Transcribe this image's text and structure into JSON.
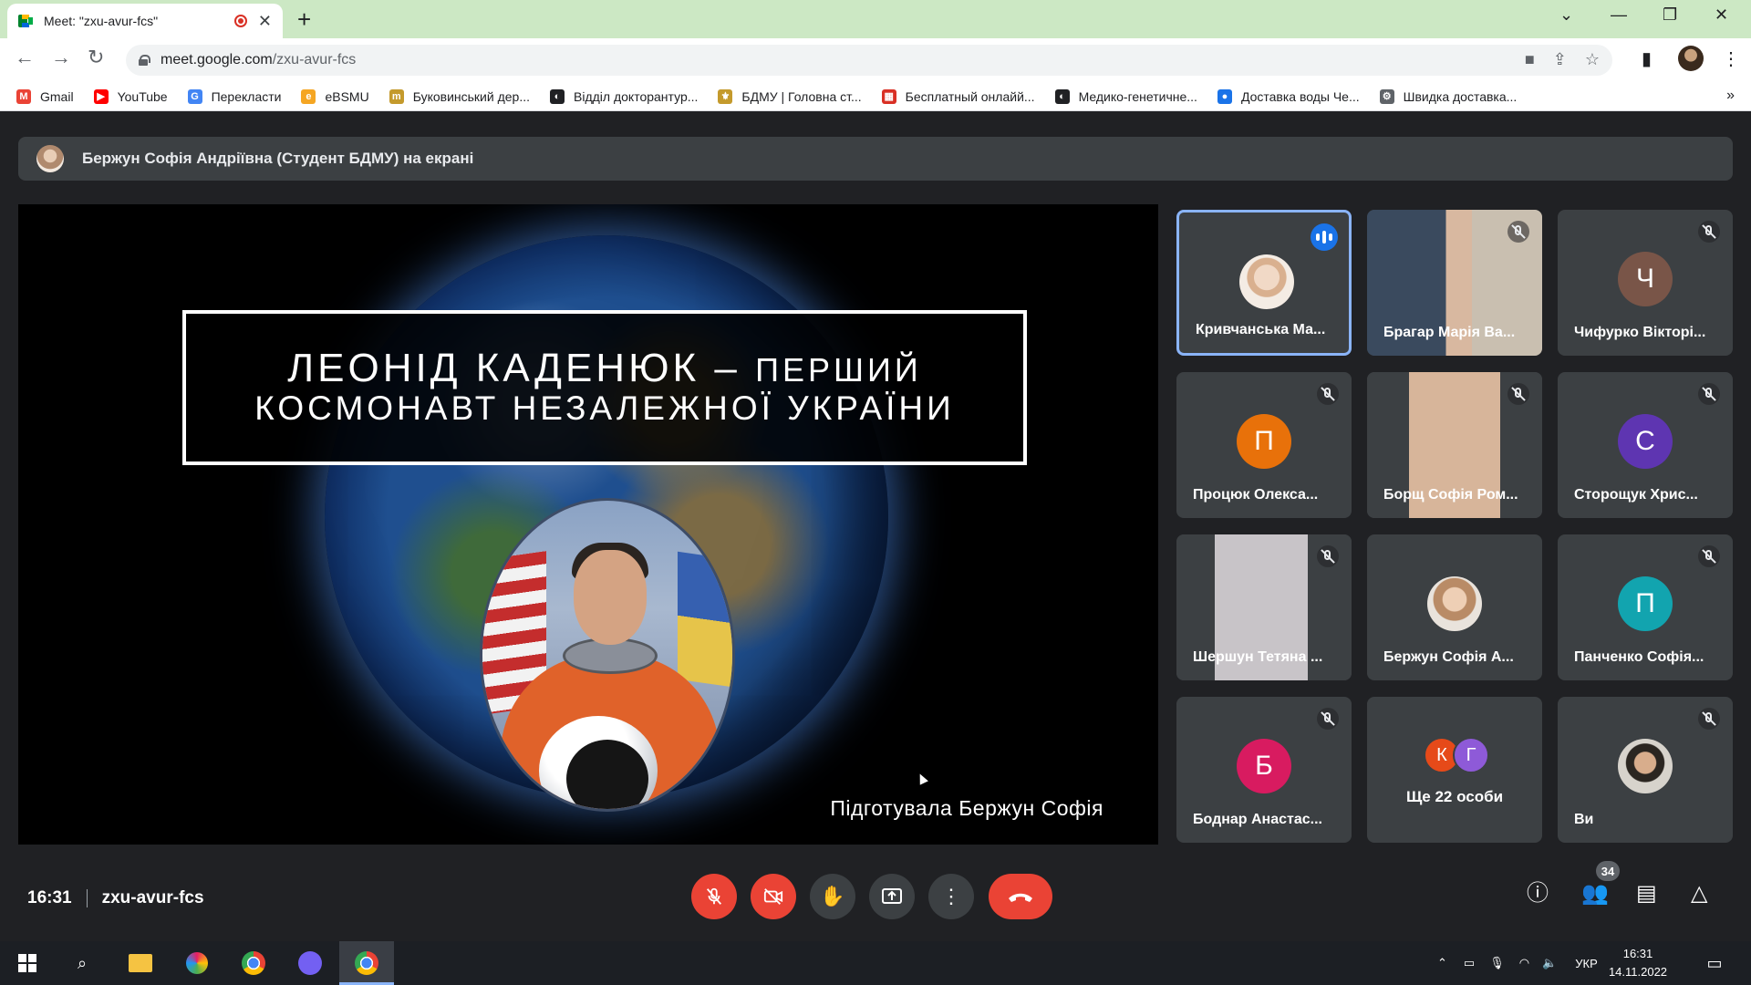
{
  "browser": {
    "tab_title": "Meet: \"zxu-avur-fcs\"",
    "url_host": "meet.google.com",
    "url_path": "/zxu-avur-fcs",
    "bookmarks": [
      {
        "label": "Gmail",
        "color": "#ea4335",
        "glyph": "M"
      },
      {
        "label": "YouTube",
        "color": "#ff0000",
        "glyph": "▶"
      },
      {
        "label": "Перекласти",
        "color": "#4285f4",
        "glyph": "G"
      },
      {
        "label": "eBSMU",
        "color": "#f5a623",
        "glyph": "e"
      },
      {
        "label": "Буковинський дер...",
        "color": "#c49a2c",
        "glyph": "m"
      },
      {
        "label": "Відділ докторантур...",
        "color": "#202124",
        "glyph": "◐"
      },
      {
        "label": "БДМУ | Головна ст...",
        "color": "#c49a2c",
        "glyph": "⚜"
      },
      {
        "label": "Бесплатный онлайй...",
        "color": "#d93025",
        "glyph": "▦"
      },
      {
        "label": "Медико-генетичне...",
        "color": "#202124",
        "glyph": "◐"
      },
      {
        "label": "Доставка воды Че...",
        "color": "#1a73e8",
        "glyph": "●"
      },
      {
        "label": "Швидка доставка...",
        "color": "#5f6368",
        "glyph": "⚙"
      }
    ]
  },
  "meet": {
    "presenter_banner": "Бержун Софія Андріївна (Студент БДМУ) на екрані",
    "slide": {
      "title_line1_main": "ЛЕОНІД КАДЕНЮК – ",
      "title_line1_small": "ПЕРШИЙ",
      "title_line2": "КОСМОНАВТ НЕЗАЛЕЖНОЇ УКРАЇНИ",
      "prepared_by": "Підготувала Бержун Софія"
    },
    "participants": [
      {
        "name": "Кривчанська Ма...",
        "kind": "photo",
        "speaking": true
      },
      {
        "name": "Брагар Марія Ва...",
        "kind": "video",
        "muted": true
      },
      {
        "name": "Чифурко Вікторі...",
        "kind": "letter",
        "letter": "Ч",
        "color": "#795548",
        "muted": true
      },
      {
        "name": "Процюк Олекса...",
        "kind": "letter",
        "letter": "П",
        "color": "#e8710a",
        "muted": true
      },
      {
        "name": "Борщ Софія Ром...",
        "kind": "video",
        "muted": true
      },
      {
        "name": "Сторощук Хрис...",
        "kind": "letter",
        "letter": "С",
        "color": "#5e35b1",
        "muted": true
      },
      {
        "name": "Шершун Тетяна ...",
        "kind": "video",
        "muted": true
      },
      {
        "name": "Бержун Софія А...",
        "kind": "photo",
        "muted": false
      },
      {
        "name": "Панченко Софія...",
        "kind": "letter",
        "letter": "П",
        "color": "#12a4af",
        "muted": true
      },
      {
        "name": "Боднар Анастас...",
        "kind": "letter",
        "letter": "Б",
        "color": "#d81b60",
        "muted": true
      },
      {
        "name": "Ще 22 особи",
        "kind": "more",
        "letters": [
          "К",
          "Г"
        ],
        "colors": [
          "#e64a19",
          "#8e5ad8"
        ]
      },
      {
        "name": "Ви",
        "kind": "photo",
        "muted": true
      }
    ],
    "time": "16:31",
    "meeting_code": "zxu-avur-fcs",
    "participant_count": "34"
  },
  "taskbar": {
    "language": "УКР",
    "time": "16:31",
    "date": "14.11.2022"
  }
}
